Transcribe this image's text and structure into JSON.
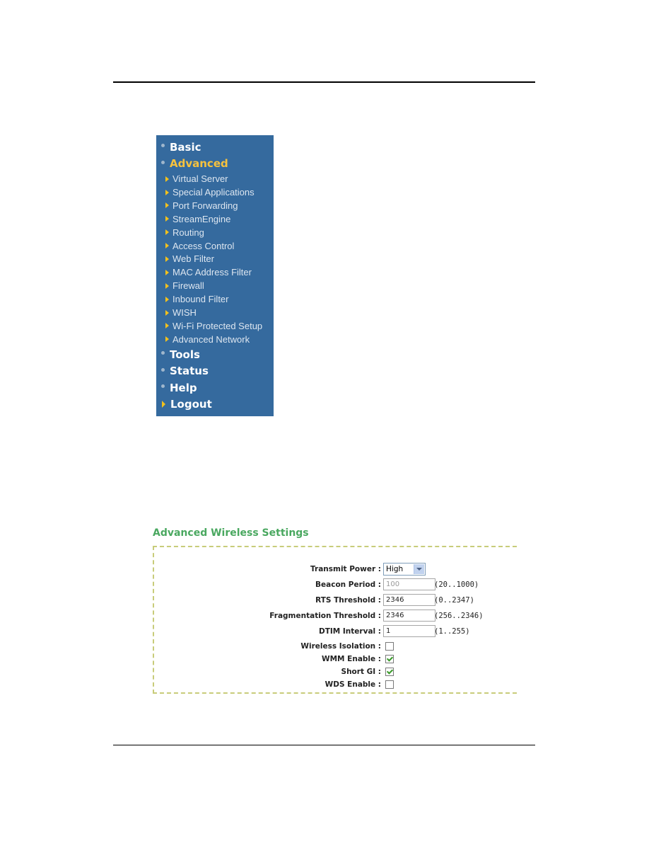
{
  "sidebar": {
    "top_items": [
      {
        "label": "Basic",
        "icon": "bullet-dot-icon",
        "active": false
      },
      {
        "label": "Advanced",
        "icon": "bullet-dot-icon",
        "active": true
      }
    ],
    "sub_items": [
      {
        "label": "Virtual Server"
      },
      {
        "label": "Special Applications"
      },
      {
        "label": "Port Forwarding"
      },
      {
        "label": "StreamEngine"
      },
      {
        "label": "Routing"
      },
      {
        "label": "Access Control"
      },
      {
        "label": "Web Filter"
      },
      {
        "label": "MAC Address Filter"
      },
      {
        "label": "Firewall"
      },
      {
        "label": "Inbound Filter"
      },
      {
        "label": "WISH"
      },
      {
        "label": "Wi-Fi Protected Setup"
      },
      {
        "label": "Advanced Network"
      }
    ],
    "bottom_items": [
      {
        "label": "Tools",
        "icon": "bullet-dot-icon"
      },
      {
        "label": "Status",
        "icon": "bullet-dot-icon"
      },
      {
        "label": "Help",
        "icon": "bullet-dot-icon"
      },
      {
        "label": "Logout",
        "icon": "arrow-right-icon"
      }
    ],
    "colors": {
      "background": "#356a9e",
      "active": "#f6c23e",
      "arrow": "#f3c11c"
    }
  },
  "settings": {
    "title": "Advanced Wireless Settings",
    "title_color": "#4aa860",
    "fields": {
      "transmit_power": {
        "label": "Transmit Power :",
        "value": "High"
      },
      "beacon_period": {
        "label": "Beacon Period :",
        "value": "100",
        "range": "(20..1000)"
      },
      "rts_threshold": {
        "label": "RTS Threshold :",
        "value": "2346",
        "range": "(0..2347)"
      },
      "fragmentation_threshold": {
        "label": "Fragmentation Threshold :",
        "value": "2346",
        "range": "(256..2346)"
      },
      "dtim_interval": {
        "label": "DTIM Interval :",
        "value": "1",
        "range": "(1..255)"
      },
      "wireless_isolation": {
        "label": "Wireless Isolation :",
        "checked": false
      },
      "wmm_enable": {
        "label": "WMM Enable :",
        "checked": true
      },
      "short_gi": {
        "label": "Short GI :",
        "checked": true
      },
      "wds_enable": {
        "label": "WDS Enable :",
        "checked": false
      }
    }
  }
}
